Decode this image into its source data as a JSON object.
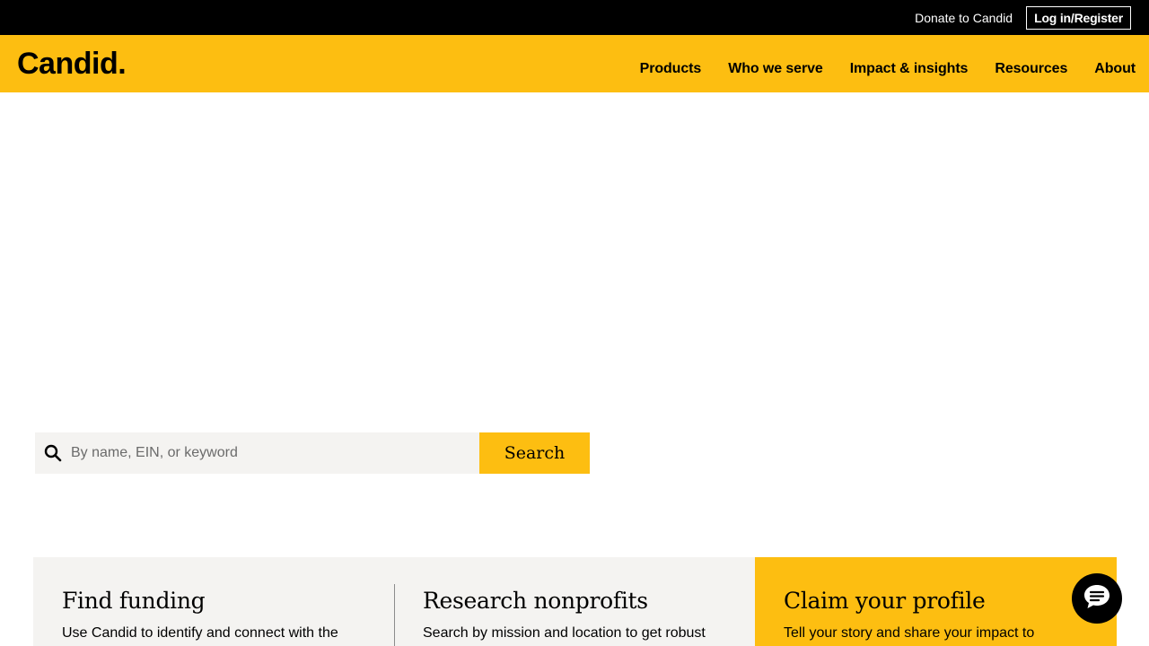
{
  "utility": {
    "donate_label": "Donate to Candid",
    "login_label": "Log in/Register"
  },
  "header": {
    "logo": "Candid.",
    "nav": [
      "Products",
      "Who we serve",
      "Impact & insights",
      "Resources",
      "About"
    ]
  },
  "search": {
    "placeholder": "By name, EIN, or keyword",
    "value": "",
    "button_label": "Search",
    "icon": "search-icon"
  },
  "features": [
    {
      "title": "Find funding",
      "description": "Use Candid to identify and connect with the"
    },
    {
      "title": "Research nonprofits",
      "description": "Search by mission and location to get robust"
    },
    {
      "title": "Claim your profile",
      "description": "Tell your story and share your impact to"
    }
  ],
  "chat": {
    "icon": "chat-bubble-icon"
  },
  "colors": {
    "brand_yellow": "#fdbe11",
    "utility_bar": "#000000",
    "card_gray": "#f4f3f1"
  }
}
